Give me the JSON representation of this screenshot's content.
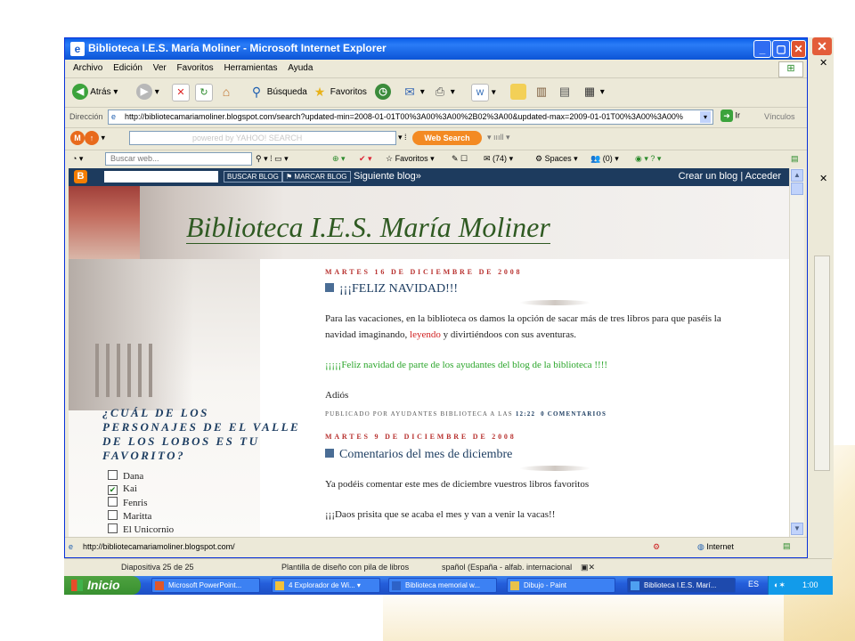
{
  "window": {
    "title": "Biblioteca I.E.S. María Moliner - Microsoft Internet Explorer"
  },
  "menu": [
    "Archivo",
    "Edición",
    "Ver",
    "Favoritos",
    "Herramientas",
    "Ayuda"
  ],
  "toolbar": {
    "back": "Atrás",
    "search": "Búsqueda",
    "favorites": "Favoritos"
  },
  "address": {
    "label": "Dirección",
    "url": "http://bibliotecamariamoliner.blogspot.com/search?updated-min=2008-01-01T00%3A00%3A00%2B02%3A00&updated-max=2009-01-01T00%3A00%3A00%",
    "go": "Ir",
    "links": "Vínculos"
  },
  "yahoo": {
    "placeholder": "powered by YAHOO! SEARCH",
    "button": "Web Search"
  },
  "live": {
    "search_placeholder": "Buscar web...",
    "favorites": "Favoritos",
    "mail": "(74)",
    "spaces": "Spaces",
    "contacts": "(0)"
  },
  "blogger": {
    "search_btn": "BUSCAR BLOG",
    "mark_btn": "MARCAR BLOG",
    "next": "Siguiente blog»",
    "create": "Crear un blog | Acceder"
  },
  "blog": {
    "title": "Biblioteca I.E.S. María Moliner"
  },
  "poll": {
    "question": "¿CUÁL DE LOS PERSONAJES DE EL VALLE DE LOS LOBOS ES TU FAVORITO?",
    "options": [
      {
        "label": "Dana",
        "checked": false
      },
      {
        "label": "Kai",
        "checked": true
      },
      {
        "label": "Fenris",
        "checked": false
      },
      {
        "label": "Maritta",
        "checked": false
      },
      {
        "label": "El Unicornio",
        "checked": false
      }
    ]
  },
  "posts": [
    {
      "date": "MARTES 16 DE DICIEMBRE DE 2008",
      "title": "¡¡¡FELIZ NAVIDAD!!!",
      "body_before": "Para las vacaciones, en la biblioteca os damos la opción de sacar más de tres libros para que paséis la navidad imaginando, ",
      "body_link": "leyendo",
      "body_after": " y divirtiéndoos con sus aventuras.",
      "green": "¡¡¡¡¡Feliz navidad de parte de los ayudantes del blog de la biblioteca !!!!",
      "sign": "Adiós",
      "meta_prefix": "PUBLICADO POR AYUDANTES BIBLIOTECA A LAS ",
      "meta_time": "12:22",
      "meta_comments": "0 COMENTARIOS"
    },
    {
      "date": "MARTES 9 DE DICIEMBRE DE 2008",
      "title": "Comentarios del mes de diciembre",
      "line1": "Ya podéis comentar este mes de diciembre vuestros libros favoritos",
      "line2": "¡¡¡Daos prisita que se acaba el mes y van a venir la vacas!!"
    }
  ],
  "status": {
    "url": "http://bibliotecamariamoliner.blogspot.com/",
    "zone": "Internet"
  },
  "powerpoint_status": {
    "slide": "Diapositiva 25 de 25",
    "template": "Plantilla de diseño con pila de libros",
    "language": "spañol (España - alfab. internacional"
  },
  "taskbar": {
    "start": "Inicio",
    "tasks": [
      "Microsoft PowerPoint...",
      "4 Explorador de Wi...",
      "Biblioteca memorial w...",
      "Dibujo - Paint",
      "Biblioteca I.E.S. Marí..."
    ],
    "lang": "ES",
    "clock": "1:00"
  },
  "colors": {
    "titlebar": "#0a5ee8",
    "blognav": "#1d3b5e",
    "date_red": "#b8312f",
    "title_green": "#2f5a22",
    "green_text": "#2aa52a"
  }
}
